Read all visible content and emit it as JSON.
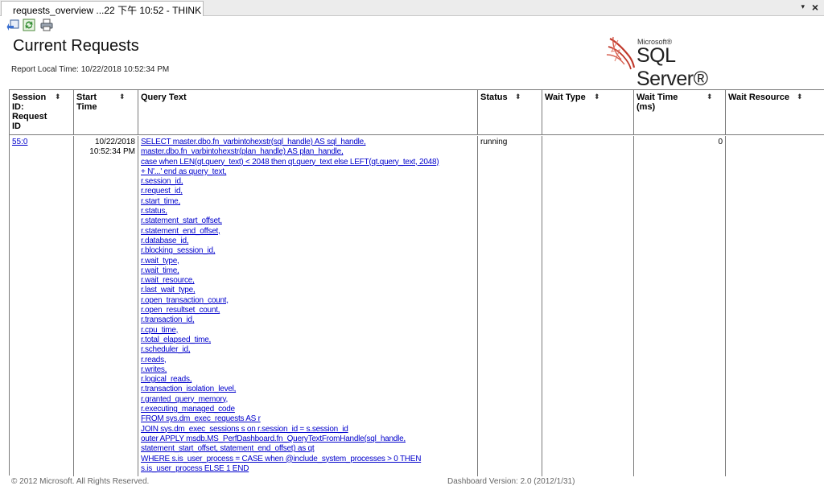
{
  "window": {
    "tab_title": "requests_overview ...22 下午 10:52 - THINK",
    "dropdown_glyph": "▾",
    "close_glyph": "×"
  },
  "toolbar": {
    "buttons": [
      {
        "name": "back-icon"
      },
      {
        "name": "refresh-icon"
      },
      {
        "name": "print-icon"
      }
    ]
  },
  "report": {
    "title": "Current Requests",
    "local_time": "Report Local Time: 10/22/2018 10:52:34 PM"
  },
  "logo": {
    "company": "Microsoft®",
    "product": "SQL Server®",
    "colors": {
      "mark": "#c0392b"
    }
  },
  "table": {
    "headers": {
      "session": "Session ID: Request ID",
      "start_time": "Start Time",
      "query_text": "Query Text",
      "status": "Status",
      "wait_type": "Wait Type",
      "wait_time": "Wait Time (ms)",
      "wait_resource": "Wait Resource"
    },
    "sort_glyph": "⬍",
    "row": {
      "session_id": "55:0",
      "start_date": "10/22/2018",
      "start_clock": "10:52:34 PM",
      "status": "running",
      "wait_type": "",
      "wait_time": "0",
      "wait_resource": "",
      "query_lines": [
        "SELECT master.dbo.fn_varbintohexstr(sql_handle) AS sql_handle,",
        "master.dbo.fn_varbintohexstr(plan_handle) AS plan_handle,",
        "case when LEN(qt.query_text) < 2048 then qt.query_text else LEFT(qt.query_text, 2048)",
        "+ N'...' end as query_text,",
        "r.session_id,",
        "r.request_id,",
        "r.start_time,",
        "r.status,",
        "r.statement_start_offset,",
        "r.statement_end_offset,",
        "r.database_id,",
        "r.blocking_session_id,",
        "r.wait_type,",
        "r.wait_time,",
        "r.wait_resource,",
        "r.last_wait_type,",
        "r.open_transaction_count,",
        "r.open_resultset_count,",
        "r.transaction_id,",
        "r.cpu_time,",
        "r.total_elapsed_time,",
        "r.scheduler_id,",
        "r.reads,",
        "r.writes,",
        "r.logical_reads,",
        "r.transaction_isolation_level,",
        "r.granted_query_memory,",
        "r.executing_managed_code",
        "FROM sys.dm_exec_requests AS r",
        "JOIN sys.dm_exec_sessions s on r.session_id = s.session_id",
        "outer APPLY msdb.MS_PerfDashboard.fn_QueryTextFromHandle(sql_handle,",
        "statement_start_offset, statement_end_offset) as qt",
        "WHERE s.is_user_process = CASE when @include_system_processes > 0 THEN",
        "s.is_user_process ELSE 1 END"
      ]
    }
  },
  "footer": {
    "copyright": "© 2012 Microsoft. All Rights Reserved.",
    "version": "Dashboard Version: 2.0 (2012/1/31)"
  }
}
